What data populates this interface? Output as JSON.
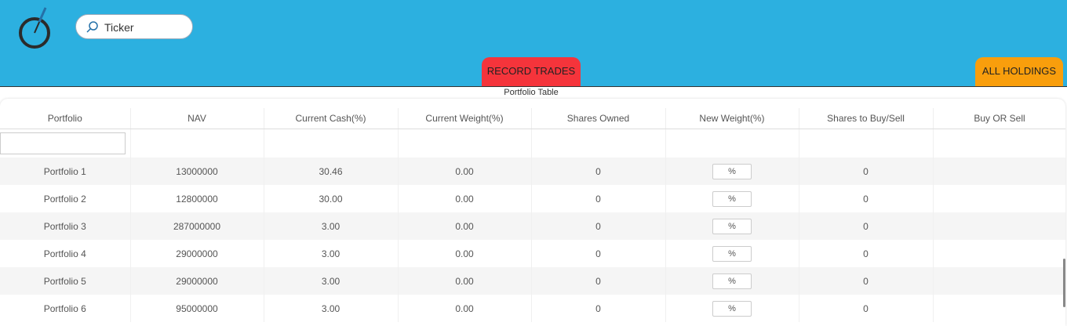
{
  "search": {
    "placeholder": "Ticker"
  },
  "tabs": {
    "record_trades": "RECORD TRADES",
    "all_holdings": "ALL HOLDINGS"
  },
  "table": {
    "title": "Portfolio Table",
    "columns": [
      "Portfolio",
      "NAV",
      "Current Cash(%)",
      "Current Weight(%)",
      "Shares Owned",
      "New Weight(%)",
      "Shares to Buy/Sell",
      "Buy OR Sell"
    ],
    "rows": [
      {
        "portfolio": "Portfolio 1",
        "nav": "13000000",
        "cash": "30.46",
        "weight": "0.00",
        "owned": "0",
        "new_weight": "%",
        "to_trade": "0",
        "side": ""
      },
      {
        "portfolio": "Portfolio 2",
        "nav": "12800000",
        "cash": "30.00",
        "weight": "0.00",
        "owned": "0",
        "new_weight": "%",
        "to_trade": "0",
        "side": ""
      },
      {
        "portfolio": "Portfolio 3",
        "nav": "287000000",
        "cash": "3.00",
        "weight": "0.00",
        "owned": "0",
        "new_weight": "%",
        "to_trade": "0",
        "side": ""
      },
      {
        "portfolio": "Portfolio 4",
        "nav": "29000000",
        "cash": "3.00",
        "weight": "0.00",
        "owned": "0",
        "new_weight": "%",
        "to_trade": "0",
        "side": ""
      },
      {
        "portfolio": "Portfolio 5",
        "nav": "29000000",
        "cash": "3.00",
        "weight": "0.00",
        "owned": "0",
        "new_weight": "%",
        "to_trade": "0",
        "side": ""
      },
      {
        "portfolio": "Portfolio 6",
        "nav": "95000000",
        "cash": "3.00",
        "weight": "0.00",
        "owned": "0",
        "new_weight": "%",
        "to_trade": "0",
        "side": ""
      }
    ]
  },
  "colors": {
    "header_bg": "#2cb0e0",
    "record_tab": "#f5343b",
    "holdings_tab": "#f99e0c"
  },
  "icons": {
    "logo": "logo-icon",
    "search": "search-icon"
  }
}
